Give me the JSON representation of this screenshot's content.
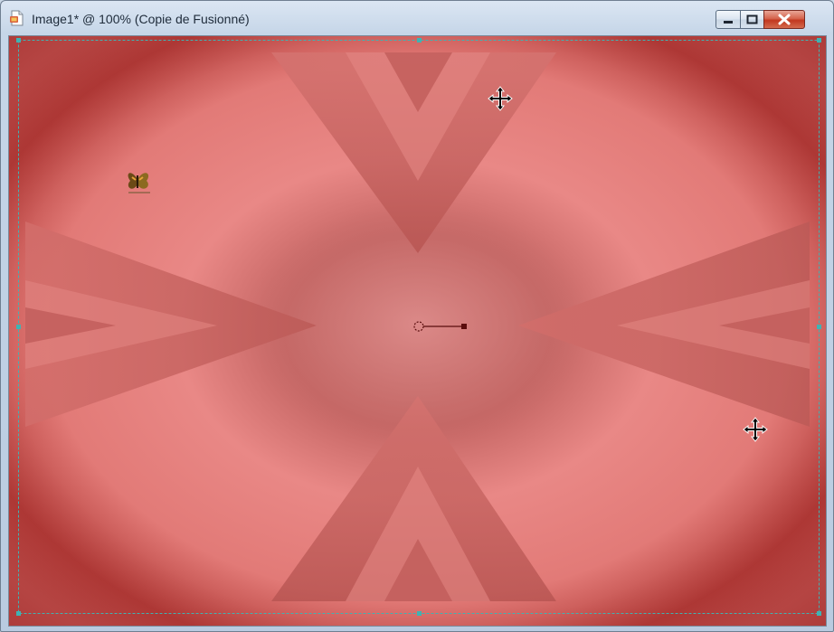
{
  "window": {
    "title": "Image1* @ 100% (Copie de Fusionné)",
    "icons": {
      "app": "psp-document-icon",
      "minimize": "minimize-icon",
      "maximize": "maximize-icon",
      "close": "close-icon"
    }
  },
  "canvas": {
    "colors": {
      "base": "#d9716e",
      "light": "#ee8c8a",
      "dark": "#951e1e",
      "selection": "#3fb3b3"
    },
    "icons": [
      "butterfly-icon",
      "move-cursor-icon",
      "rotation-pivot-icon"
    ]
  }
}
